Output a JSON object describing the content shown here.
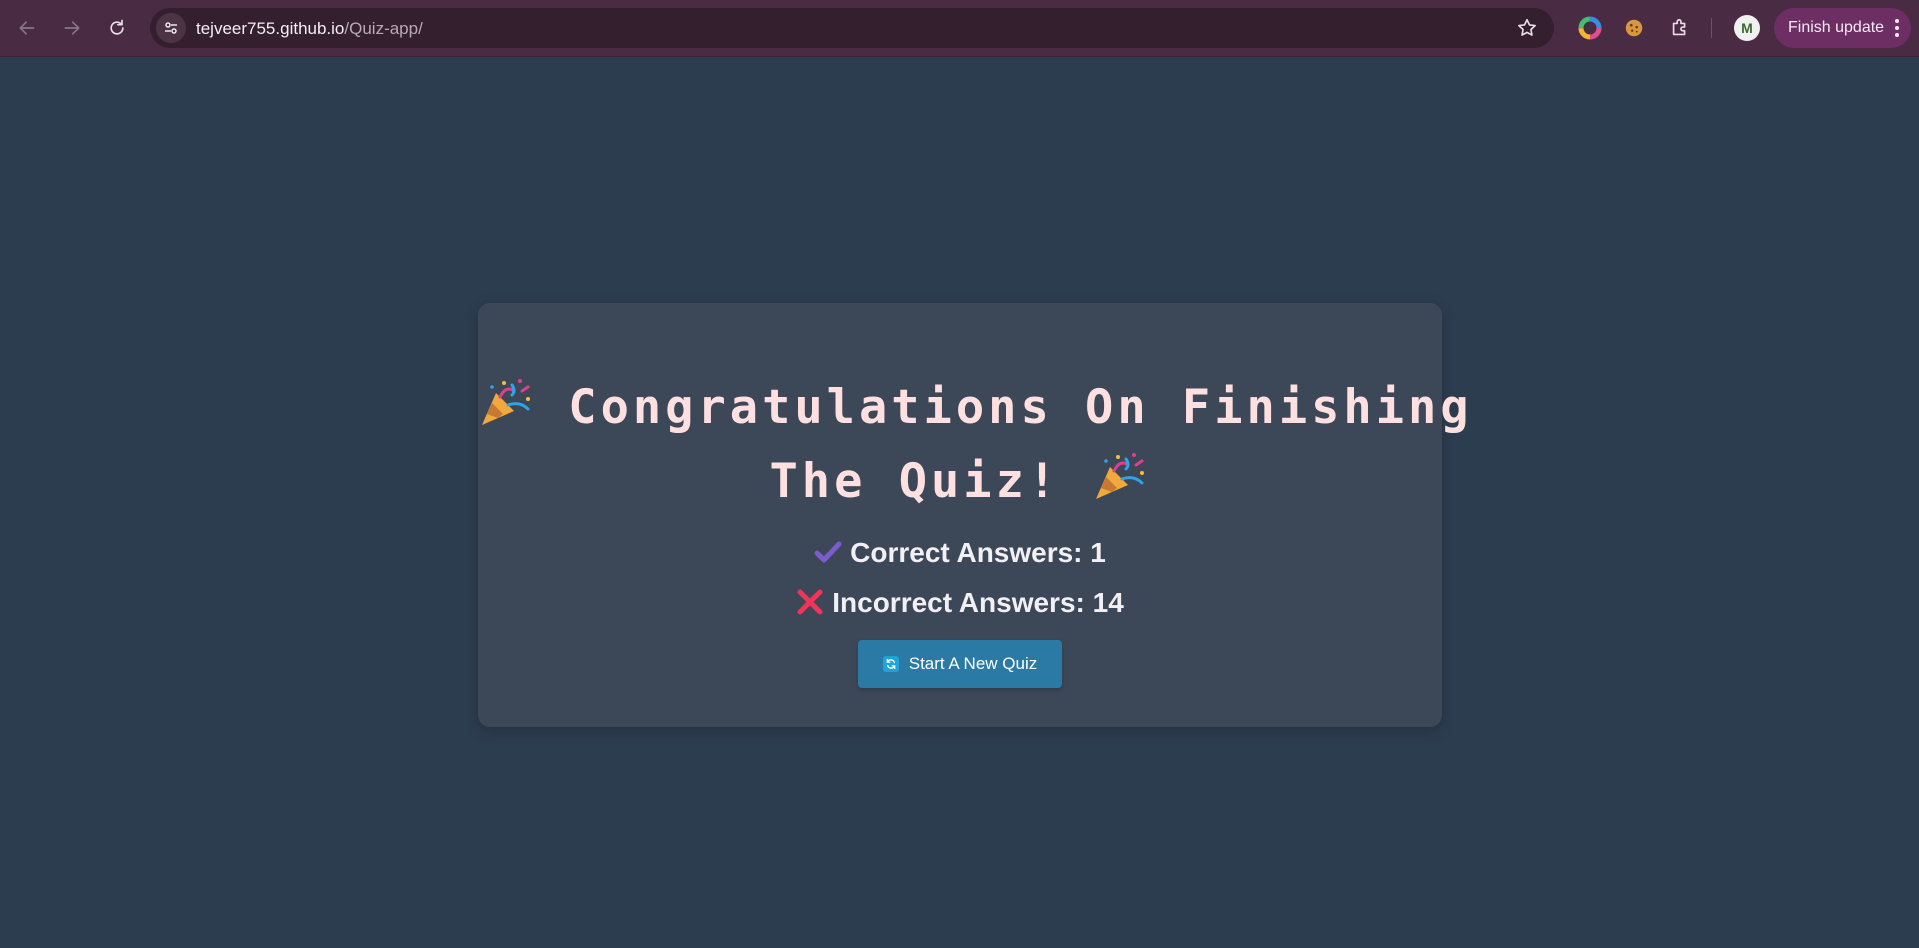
{
  "browser": {
    "url_host": "tejveer755.github.io",
    "url_path": "/Quiz-app/",
    "finish_update_label": "Finish update",
    "avatar_letter": "M",
    "accent_color": "#6d2e64"
  },
  "quiz": {
    "title_line1": "Congratulations On Finishing",
    "title_line2": "The Quiz!",
    "title_emoji": "party-popper-icon",
    "correct_label": "Correct Answers: 1",
    "incorrect_label": "Incorrect Answers: 14",
    "restart_label": "Start A New Quiz",
    "colors": {
      "background": "#2d3d50",
      "card": "#3c4758",
      "title": "#ffe0e0",
      "button": "#2b7aa6",
      "check": "#7b5ccc",
      "cross": "#f0345a"
    }
  }
}
